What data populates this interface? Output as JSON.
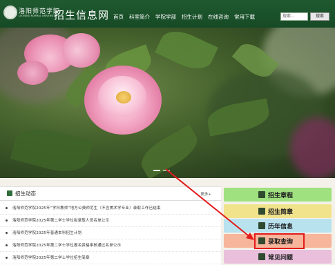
{
  "header": {
    "logo_cn": "洛阳师范学院",
    "logo_en": "LUOYANG NORMAL UNIVERSITY",
    "site_title": "招生信息网",
    "nav": [
      "首页",
      "科室简介",
      "学院学部",
      "招生计划",
      "在线咨询",
      "常用下载"
    ],
    "search_placeholder": "搜索...",
    "search_button": "搜索"
  },
  "banner": {
    "slides": 2,
    "active_slide": 1
  },
  "news": {
    "title": "招生动态",
    "more": "更多+",
    "items": [
      "洛阳师范学院2025年“学科教师”地方公费师范生（不含美术学专业）录取工作已结束",
      "洛阳师范学院2025年第二学士学位拟录取人员名单公示",
      "洛阳师范学院2025年普通本科招生计划",
      "洛阳师范学院2025年第二学士学位报名资格审核通过名单公示",
      "洛阳师范学院2025年第二学士学位招生简章"
    ]
  },
  "quick_links": [
    {
      "label": "招生章程",
      "color": "#9fe07f",
      "icon": "book-icon"
    },
    {
      "label": "招生简章",
      "color": "#f1e38c",
      "icon": "document-icon"
    },
    {
      "label": "历年信息",
      "color": "#b9e2ef",
      "icon": "calendar-icon"
    },
    {
      "label": "录取查询",
      "color": "#f7b59b",
      "icon": "graduation-cap-icon"
    },
    {
      "label": "常见问题",
      "color": "#e9bfdc",
      "icon": "question-icon"
    }
  ],
  "colors": {
    "header_green": "#1f5a2f",
    "highlight_red": "#e21b1b"
  }
}
